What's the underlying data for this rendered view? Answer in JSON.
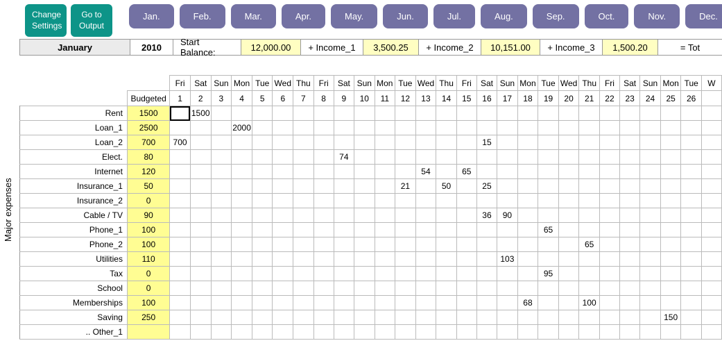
{
  "buttons": {
    "settings": "Change\nSettings",
    "output": "Go to\nOutput"
  },
  "months_short": [
    "Jan.",
    "Feb.",
    "Mar.",
    "Apr.",
    "May.",
    "Jun.",
    "Jul.",
    "Aug.",
    "Sep.",
    "Oct.",
    "Nov.",
    "Dec."
  ],
  "header": {
    "month": "January",
    "year": "2010",
    "start_balance_label": "Start Balance:",
    "start_balance": "12,000.00",
    "income1_label": "+ Income_1",
    "income1": "3,500.25",
    "income2_label": "+ Income_2",
    "income2": "10,151.00",
    "income3_label": "+ Income_3",
    "income3": "1,500.20",
    "total_label": "= Tot"
  },
  "section_label": "Major expenses",
  "budget_header": "Budgeted",
  "day_names": [
    "Fri",
    "Sat",
    "Sun",
    "Mon",
    "Tue",
    "Wed",
    "Thu",
    "Fri",
    "Sat",
    "Sun",
    "Mon",
    "Tue",
    "Wed",
    "Thu",
    "Fri",
    "Sat",
    "Sun",
    "Mon",
    "Tue",
    "Wed",
    "Thu",
    "Fri",
    "Sat",
    "Sun",
    "Mon",
    "Tue",
    "W"
  ],
  "day_nums": [
    "1",
    "2",
    "3",
    "4",
    "5",
    "6",
    "7",
    "8",
    "9",
    "10",
    "11",
    "12",
    "13",
    "14",
    "15",
    "16",
    "17",
    "18",
    "19",
    "20",
    "21",
    "22",
    "23",
    "24",
    "25",
    "26",
    ""
  ],
  "rows": [
    {
      "name": "Rent",
      "budget": "1500",
      "cells": {
        "2": "1500"
      }
    },
    {
      "name": "Loan_1",
      "budget": "2500",
      "cells": {
        "4": "2000"
      }
    },
    {
      "name": "Loan_2",
      "budget": "700",
      "cells": {
        "1": "700",
        "16": "15"
      }
    },
    {
      "name": "Elect.",
      "budget": "80",
      "cells": {
        "9": "74"
      }
    },
    {
      "name": "Internet",
      "budget": "120",
      "cells": {
        "13": "54",
        "15": "65"
      }
    },
    {
      "name": "Insurance_1",
      "budget": "50",
      "cells": {
        "12": "21",
        "14": "50",
        "16": "25"
      }
    },
    {
      "name": "Insurance_2",
      "budget": "0",
      "cells": {}
    },
    {
      "name": "Cable / TV",
      "budget": "90",
      "cells": {
        "16": "36",
        "17": "90"
      }
    },
    {
      "name": "Phone_1",
      "budget": "100",
      "cells": {
        "19": "65"
      }
    },
    {
      "name": "Phone_2",
      "budget": "100",
      "cells": {
        "21": "65"
      }
    },
    {
      "name": "Utilities",
      "budget": "110",
      "cells": {
        "17": "103"
      }
    },
    {
      "name": "Tax",
      "budget": "0",
      "cells": {
        "19": "95"
      }
    },
    {
      "name": "School",
      "budget": "0",
      "cells": {}
    },
    {
      "name": "Memberships",
      "budget": "100",
      "cells": {
        "18": "68",
        "21": "100"
      }
    },
    {
      "name": "Saving",
      "budget": "250",
      "cells": {
        "25": "150"
      }
    },
    {
      "name": ".. Other_1",
      "budget": "",
      "cells": {}
    }
  ],
  "selected_cell": {
    "row": 0,
    "day": 1
  }
}
